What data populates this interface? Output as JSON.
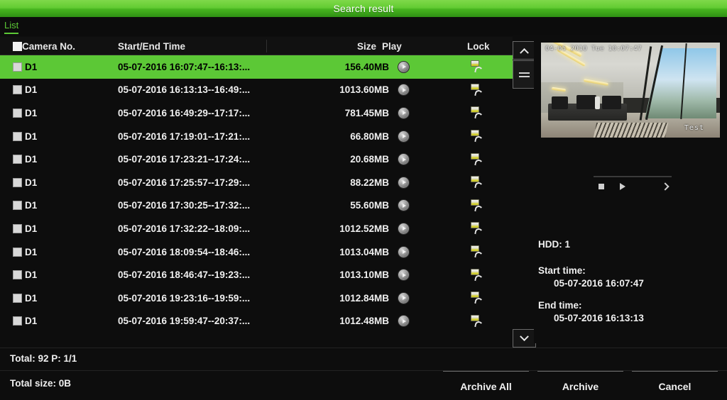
{
  "window": {
    "title": "Search result"
  },
  "tabs": [
    {
      "label": "List",
      "active": true
    }
  ],
  "table": {
    "headers": {
      "camera": "Camera No.",
      "time": "Start/End Time",
      "size": "Size",
      "play": "Play",
      "lock": "Lock"
    },
    "rows": [
      {
        "camera": "D1",
        "time": "05-07-2016 16:07:47--16:13:...",
        "size": "156.40MB",
        "lock": "unlocked",
        "selected": true
      },
      {
        "camera": "D1",
        "time": "05-07-2016 16:13:13--16:49:...",
        "size": "1013.60MB",
        "lock": "unlocked",
        "selected": false
      },
      {
        "camera": "D1",
        "time": "05-07-2016 16:49:29--17:17:...",
        "size": "781.45MB",
        "lock": "unlocked",
        "selected": false
      },
      {
        "camera": "D1",
        "time": "05-07-2016 17:19:01--17:21:...",
        "size": "66.80MB",
        "lock": "unlocked",
        "selected": false
      },
      {
        "camera": "D1",
        "time": "05-07-2016 17:23:21--17:24:...",
        "size": "20.68MB",
        "lock": "unlocked",
        "selected": false
      },
      {
        "camera": "D1",
        "time": "05-07-2016 17:25:57--17:29:...",
        "size": "88.22MB",
        "lock": "unlocked",
        "selected": false
      },
      {
        "camera": "D1",
        "time": "05-07-2016 17:30:25--17:32:...",
        "size": "55.60MB",
        "lock": "unlocked",
        "selected": false
      },
      {
        "camera": "D1",
        "time": "05-07-2016 17:32:22--18:09:...",
        "size": "1012.52MB",
        "lock": "unlocked",
        "selected": false
      },
      {
        "camera": "D1",
        "time": "05-07-2016 18:09:54--18:46:...",
        "size": "1013.04MB",
        "lock": "unlocked",
        "selected": false
      },
      {
        "camera": "D1",
        "time": "05-07-2016 18:46:47--19:23:...",
        "size": "1013.10MB",
        "lock": "unlocked",
        "selected": false
      },
      {
        "camera": "D1",
        "time": "05-07-2016 19:23:16--19:59:...",
        "size": "1012.84MB",
        "lock": "unlocked",
        "selected": false
      },
      {
        "camera": "D1",
        "time": "05-07-2016 19:59:47--20:37:...",
        "size": "1012.48MB",
        "lock": "unlocked",
        "selected": false
      }
    ]
  },
  "preview": {
    "overlay_timestamp": "04-05 2010 Tue 10:07:47",
    "watermark": "Test"
  },
  "playback": {
    "stop": "stop-button",
    "play": "play-button",
    "next": "next-button"
  },
  "details": {
    "hdd": "HDD: 1",
    "start_label": "Start time:",
    "start_value": "05-07-2016 16:07:47",
    "end_label": "End time:",
    "end_value": "05-07-2016 16:13:13"
  },
  "status": {
    "total": "Total: 92  P: 1/1",
    "total_size": "Total size: 0B"
  },
  "buttons": {
    "archive_all": "Archive All",
    "archive": "Archive",
    "cancel": "Cancel"
  },
  "colors": {
    "accent_green": "#5cc836",
    "title_gradient_top": "#7fd94a",
    "title_gradient_bottom": "#2f8f14",
    "background": "#0d0d0d",
    "text": "#f0f0f0"
  }
}
